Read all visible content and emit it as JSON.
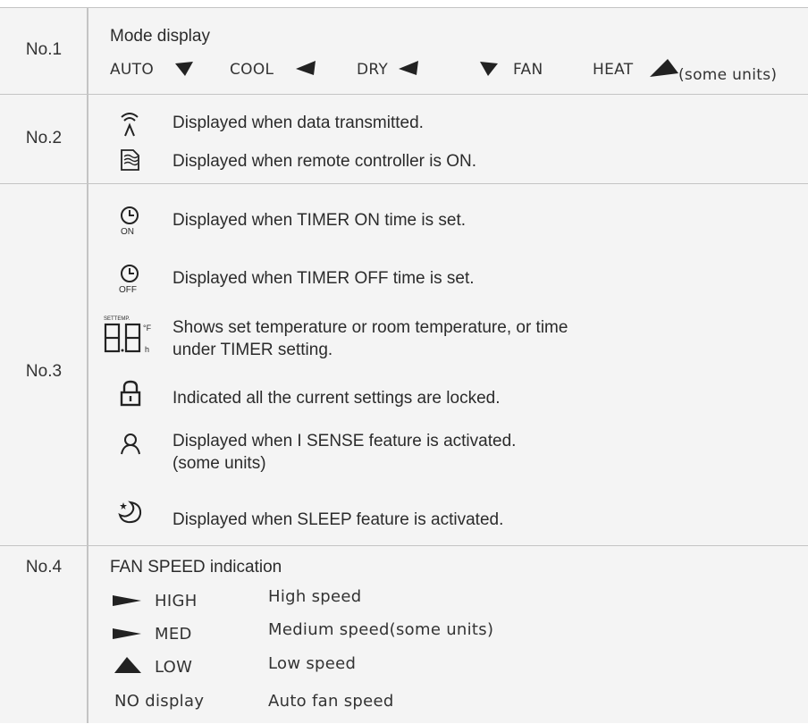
{
  "rows": [
    {
      "label": "No.1",
      "heading": "Mode display",
      "modes": [
        "AUTO",
        "COOL",
        "DRY",
        "FAN",
        "HEAT",
        "(some units)"
      ]
    },
    {
      "label": "No.2",
      "items": [
        "Displayed when data transmitted.",
        "Displayed when remote controller is ON."
      ]
    },
    {
      "label": "No.3",
      "items": [
        "Displayed when TIMER ON time is set.",
        "Displayed when TIMER OFF time is set.",
        "Shows set temperature or room temperature, or time",
        "under TIMER setting.",
        "Indicated all the current settings are locked.",
        "Displayed when I SENSE feature is activated.",
        "(some units)",
        "Displayed when SLEEP feature is activated."
      ],
      "icon_text": {
        "on": "ON",
        "off": "OFF",
        "settemp": "SETTEMP.",
        "deg": "°F",
        "h": "h",
        "digits": "88"
      }
    },
    {
      "label": "No.4",
      "heading": "FAN SPEED indication",
      "speeds": [
        {
          "name": "HIGH",
          "desc": "High speed"
        },
        {
          "name": "MED",
          "desc": "Medium speed(some units)"
        },
        {
          "name": "LOW",
          "desc": "Low speed"
        },
        {
          "name": "NO display",
          "desc": "Auto fan speed"
        }
      ]
    }
  ],
  "colors": {
    "background": "#f4f4f4",
    "border": "#c4c4c4",
    "text": "#2b2b2b"
  }
}
